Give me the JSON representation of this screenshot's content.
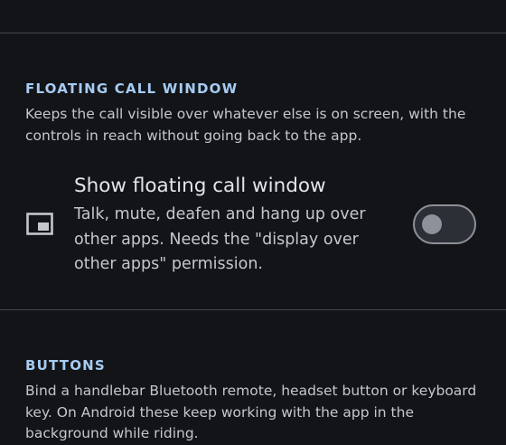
{
  "floating_section": {
    "title": "FLOATING CALL WINDOW",
    "description": "Keeps the call visible over whatever else is on screen, with the controls in reach without going back to the app."
  },
  "floating_pref": {
    "icon": "picture-in-picture-icon",
    "title": "Show floating call window",
    "summary": "Talk, mute, deafen and hang up over other apps. Needs the \"display over other apps\" permission.",
    "enabled": false
  },
  "buttons_section": {
    "title": "BUTTONS",
    "description": "Bind a handlebar Bluetooth remote, headset button or keyboard key. On Android these keep working with the app in the background while riding."
  },
  "colors": {
    "background": "#121417",
    "accent": "#a6cbf2",
    "divider": "#43474e",
    "switch_outline": "#8d9199"
  }
}
